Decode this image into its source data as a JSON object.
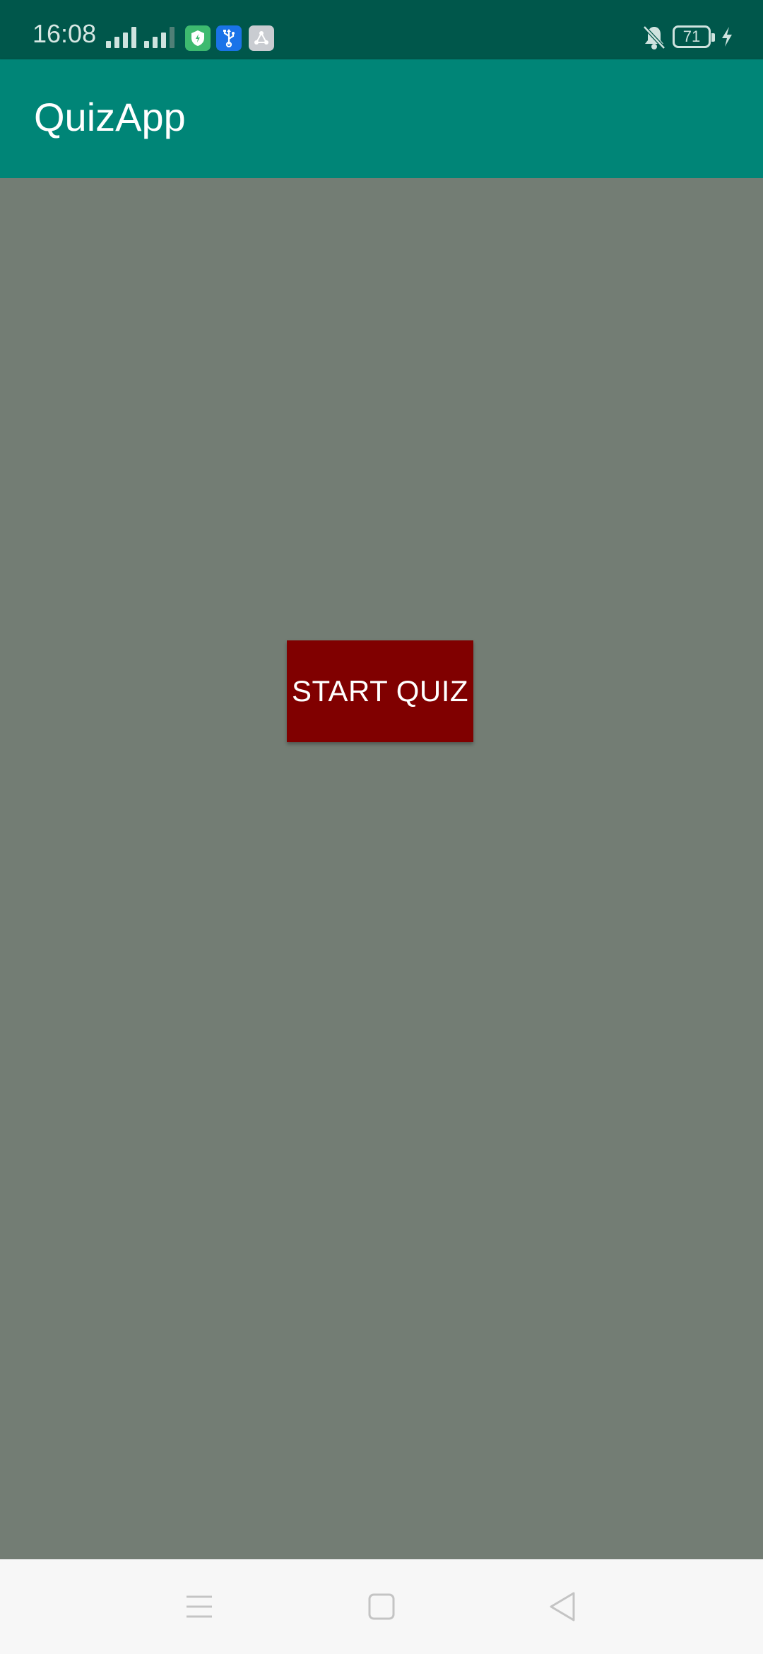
{
  "status_bar": {
    "time": "16:08",
    "battery_level": "71",
    "icons": [
      "signal-icon",
      "signal-icon",
      "shield-app-icon",
      "usb-icon",
      "share-icon",
      "bell-off-icon",
      "battery-icon",
      "charging-icon"
    ]
  },
  "app_bar": {
    "title": "QuizApp"
  },
  "main": {
    "start_button_label": "START QUIZ"
  },
  "nav_bar": {
    "icons": [
      "menu-icon",
      "home-icon",
      "back-icon"
    ]
  },
  "colors": {
    "status_bar": "#00574b",
    "app_bar": "#008577",
    "background": "#737d74",
    "button": "#800000",
    "nav_bar": "#f7f7f7"
  }
}
